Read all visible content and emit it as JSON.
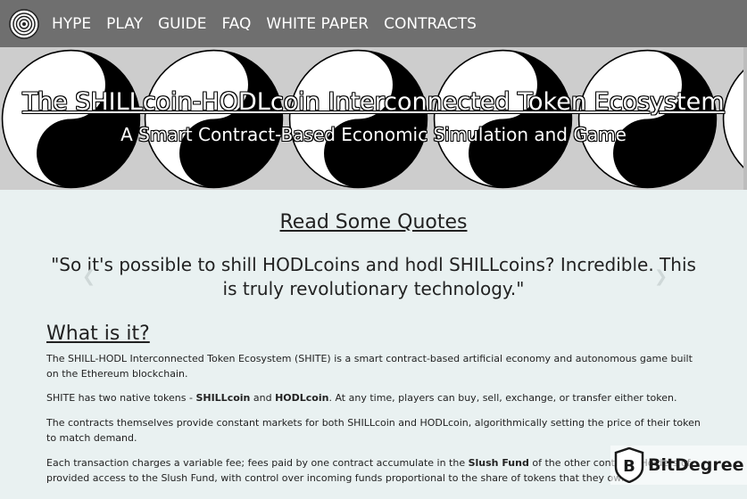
{
  "nav": {
    "items": [
      "HYPE",
      "PLAY",
      "GUIDE",
      "FAQ",
      "WHITE PAPER",
      "CONTRACTS"
    ]
  },
  "hero": {
    "title": "The SHILLcoin-HODLcoin Interconnected Token Ecosystem",
    "subtitle": "A Smart Contract-Based Economic Simulation and Game"
  },
  "quotes": {
    "heading": "Read Some Quotes",
    "text": "\"So it's possible to shill HODLcoins and hodl SHILLcoins? Incredible. This is truly revolutionary technology.\"",
    "prev_icon": "chevron-left-icon",
    "next_icon": "chevron-right-icon"
  },
  "about": {
    "heading": "What is it?",
    "p1": "The SHILL-HODL Interconnected Token Ecosystem (SHITE) is a smart contract-based artificial economy and autonomous game built on the Ethereum blockchain.",
    "p2_a": "SHITE has two native tokens - ",
    "p2_b": "SHILLcoin",
    "p2_c": " and ",
    "p2_d": "HODLcoin",
    "p2_e": ". At any time, players can buy, sell, exchange, or transfer either token.",
    "p3": "The contracts themselves provide constant markets for both SHILLcoin and HODLcoin, algorithmically setting the price of their token to match demand.",
    "p4_a": "Each transaction charges a variable fee; fees paid by one contract accumulate in the ",
    "p4_b": "Slush Fund",
    "p4_c": " of the other contract. Holders of ",
    "p4_d": "provided access to the Slush Fund, with control over incoming funds proportional to the share of tokens that they own."
  },
  "watermark": {
    "text": "BitDegree"
  }
}
